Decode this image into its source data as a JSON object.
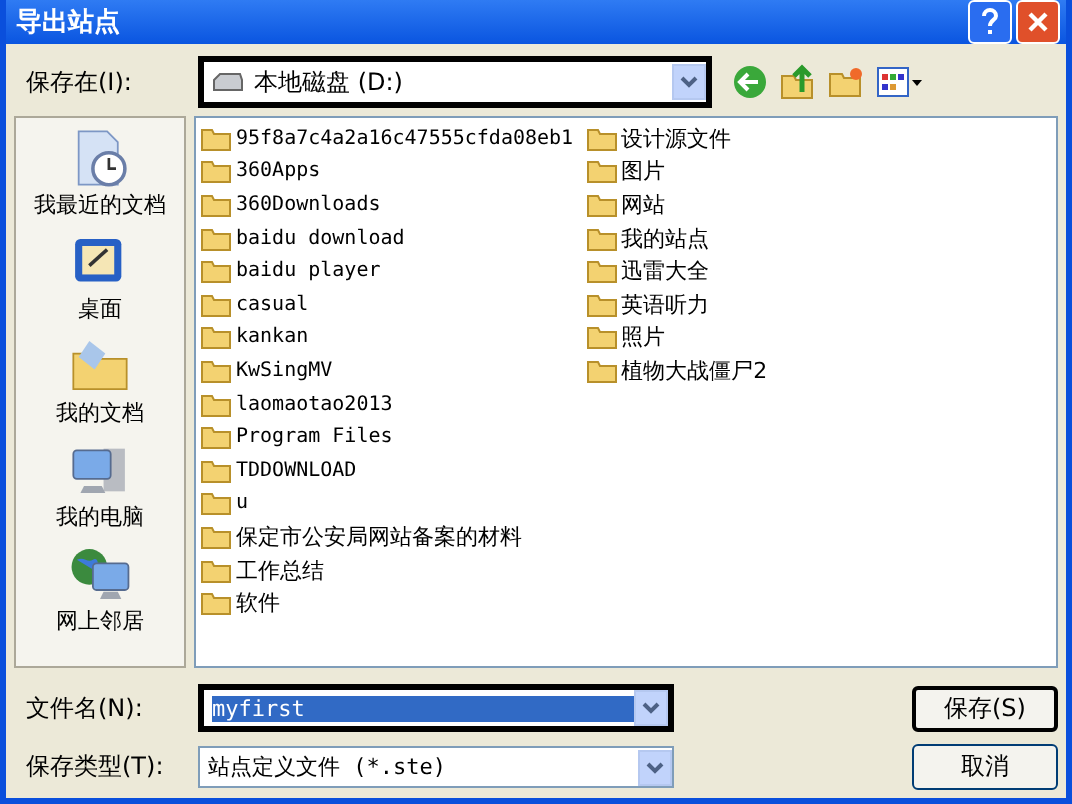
{
  "window": {
    "title": "导出站点"
  },
  "save_in": {
    "label": "保存在(I):",
    "value": "本地磁盘 (D:)"
  },
  "places": [
    {
      "label": "我最近的文档",
      "kind": "recent"
    },
    {
      "label": "桌面",
      "kind": "desktop"
    },
    {
      "label": "我的文档",
      "kind": "documents"
    },
    {
      "label": "我的电脑",
      "kind": "computer"
    },
    {
      "label": "网上邻居",
      "kind": "network"
    }
  ],
  "folders": [
    "95f8a7c4a2a16c47555cfda08eb1",
    "360Apps",
    "360Downloads",
    "baidu download",
    "baidu player",
    "casual",
    "kankan",
    "KwSingMV",
    "laomaotao2013",
    "Program Files",
    "TDDOWNLOAD",
    "u",
    "保定市公安局网站备案的材料",
    "工作总结",
    "软件",
    "设计源文件",
    "图片",
    "网站",
    "我的站点",
    "迅雷大全",
    "英语听力",
    "照片",
    "植物大战僵尸2"
  ],
  "file_name": {
    "label": "文件名(N):",
    "value": "myfirst"
  },
  "file_type": {
    "label": "保存类型(T):",
    "value": "站点定义文件 (*.ste)"
  },
  "buttons": [
    {
      "label": "保存(S)",
      "kind": "default"
    },
    {
      "label": "取消",
      "kind": "normal"
    }
  ]
}
